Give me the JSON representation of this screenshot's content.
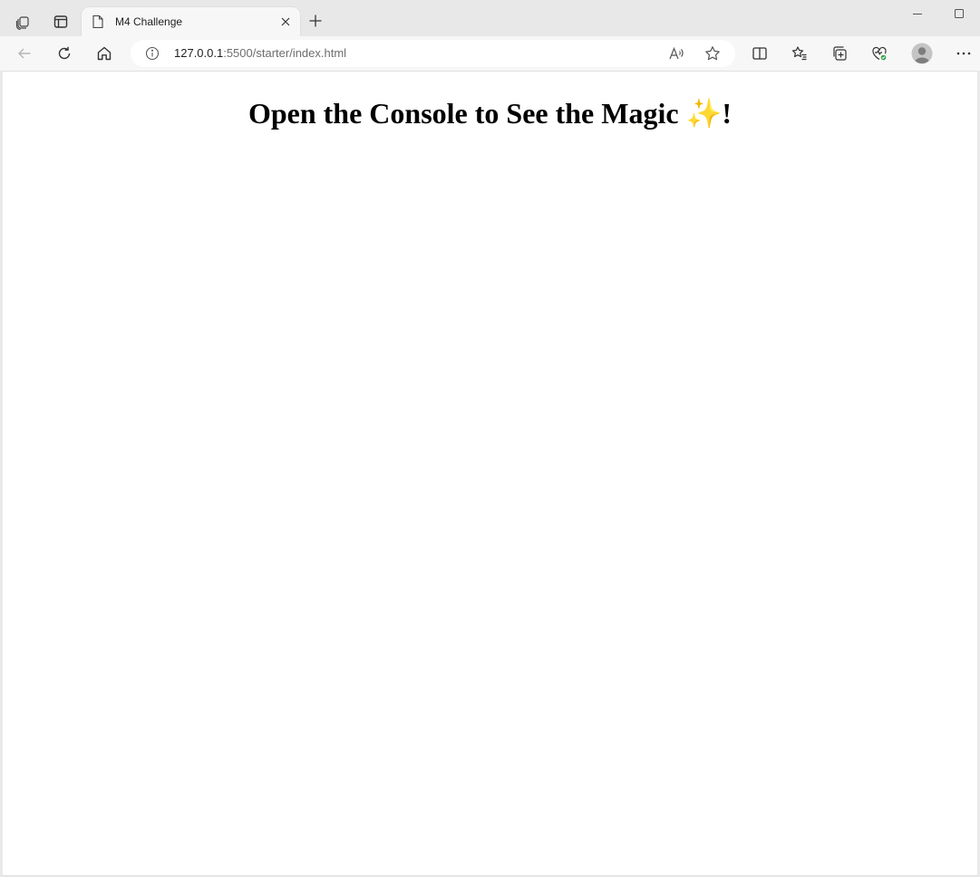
{
  "browser": {
    "tab": {
      "title": "M4 Challenge"
    },
    "address": {
      "host": "127.0.0.1",
      "rest": ":5500/starter/index.html"
    },
    "icons": {
      "workspaces": "workspaces-icon",
      "tab_actions": "tab-actions-icon",
      "page": "page-icon",
      "close": "close-icon",
      "new_tab": "plus-icon",
      "minimize": "minimize-icon",
      "maximize": "maximize-icon",
      "back": "back-arrow-icon",
      "refresh": "refresh-icon",
      "home": "home-icon",
      "info": "info-icon",
      "read_aloud": "read-aloud-icon",
      "favorite": "star-icon",
      "split_screen": "split-screen-icon",
      "favorites": "favorites-icon",
      "collections": "collections-icon",
      "browser_essentials": "browser-essentials-icon",
      "profile": "profile-avatar-icon",
      "more": "more-icon"
    }
  },
  "page": {
    "heading_text": "Open the Console to See the Magic ",
    "heading_emoji": "✨",
    "heading_end": "!"
  },
  "colors": {
    "sparkle": "#f6b93b",
    "profile_badge": "#2e9e44"
  }
}
